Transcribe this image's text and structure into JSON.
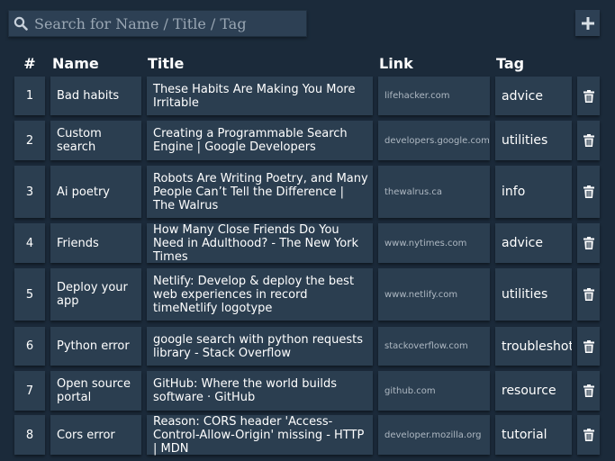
{
  "search": {
    "placeholder": "Search for Name / Title / Tag"
  },
  "headers": {
    "num": "#",
    "name": "Name",
    "title": "Title",
    "link": "Link",
    "tag": "Tag"
  },
  "rows": [
    {
      "num": "1",
      "name": "Bad habits",
      "title": "These Habits Are Making You More Irritable",
      "link": "lifehacker.com",
      "tag": "advice"
    },
    {
      "num": "2",
      "name": "Custom search",
      "title": "Creating a Programmable Search Engine  |  Google Developers",
      "link": "developers.google.com",
      "tag": "utilities"
    },
    {
      "num": "3",
      "name": "Ai poetry",
      "title": "Robots Are Writing Poetry, and Many People Can’t Tell the Difference | The Walrus",
      "link": "thewalrus.ca",
      "tag": "info"
    },
    {
      "num": "4",
      "name": "Friends",
      "title": "How Many Close Friends Do You Need in Adulthood? - The New York Times",
      "link": "www.nytimes.com",
      "tag": "advice"
    },
    {
      "num": "5",
      "name": "Deploy your app",
      "title": "Netlify: Develop & deploy the best web experiences in record timeNetlify logotype",
      "link": "www.netlify.com",
      "tag": "utilities"
    },
    {
      "num": "6",
      "name": "Python error",
      "title": "google search with python requests library - Stack Overflow",
      "link": "stackoverflow.com",
      "tag": "troubleshot"
    },
    {
      "num": "7",
      "name": "Open source portal",
      "title": "GitHub: Where the world builds software · GitHub",
      "link": "github.com",
      "tag": "resource"
    },
    {
      "num": "8",
      "name": "Cors error",
      "title": "Reason: CORS header 'Access-Control-Allow-Origin' missing - HTTP | MDN",
      "link": "developer.mozilla.org",
      "tag": "tutorial"
    }
  ]
}
